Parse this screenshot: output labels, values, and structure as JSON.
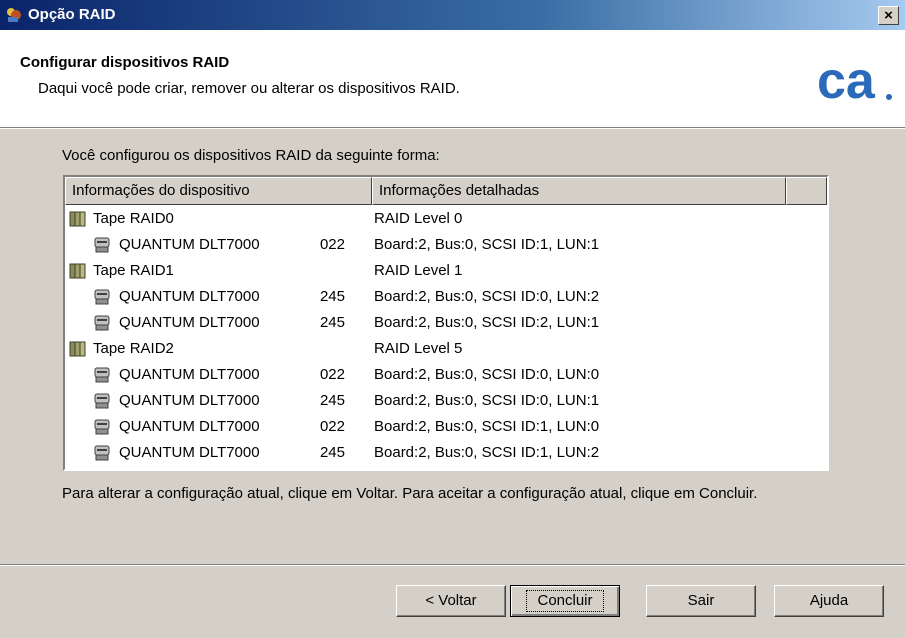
{
  "window": {
    "title": "Opção RAID",
    "close_label": "×"
  },
  "header": {
    "title": "Configurar dispositivos RAID",
    "subtitle": "Daqui você pode criar, remover ou alterar os dispositivos RAID.",
    "logo_text": "ca",
    "brand_color": "#2b6ab8"
  },
  "intro_text": "Você configurou os dispositivos RAID da seguinte forma:",
  "list": {
    "columns": [
      "Informações do dispositivo",
      "Informações detalhadas"
    ],
    "rows": [
      {
        "type": "raid",
        "name": "Tape RAID0",
        "num": "",
        "detail": "RAID Level  0"
      },
      {
        "type": "drive",
        "name": "QUANTUM DLT7000",
        "num": "022",
        "detail": "Board:2, Bus:0, SCSI ID:1, LUN:1"
      },
      {
        "type": "raid",
        "name": "Tape RAID1",
        "num": "",
        "detail": "RAID Level  1"
      },
      {
        "type": "drive",
        "name": "QUANTUM DLT7000",
        "num": "245",
        "detail": "Board:2, Bus:0, SCSI ID:0, LUN:2"
      },
      {
        "type": "drive",
        "name": "QUANTUM DLT7000",
        "num": "245",
        "detail": "Board:2, Bus:0, SCSI ID:2, LUN:1"
      },
      {
        "type": "raid",
        "name": "Tape RAID2",
        "num": "",
        "detail": "RAID Level  5"
      },
      {
        "type": "drive",
        "name": "QUANTUM DLT7000",
        "num": "022",
        "detail": "Board:2, Bus:0, SCSI ID:0, LUN:0"
      },
      {
        "type": "drive",
        "name": "QUANTUM DLT7000",
        "num": "245",
        "detail": "Board:2, Bus:0, SCSI ID:0, LUN:1"
      },
      {
        "type": "drive",
        "name": "QUANTUM DLT7000",
        "num": "022",
        "detail": "Board:2, Bus:0, SCSI ID:1, LUN:0"
      },
      {
        "type": "drive",
        "name": "QUANTUM DLT7000",
        "num": "245",
        "detail": "Board:2, Bus:0, SCSI ID:1, LUN:2"
      }
    ]
  },
  "footnote": "Para alterar a configuração atual, clique em Voltar. Para aceitar a configuração atual, clique em Concluir.",
  "buttons": {
    "back": "< Voltar",
    "finish": "Concluir",
    "exit": "Sair",
    "help": "Ajuda"
  }
}
